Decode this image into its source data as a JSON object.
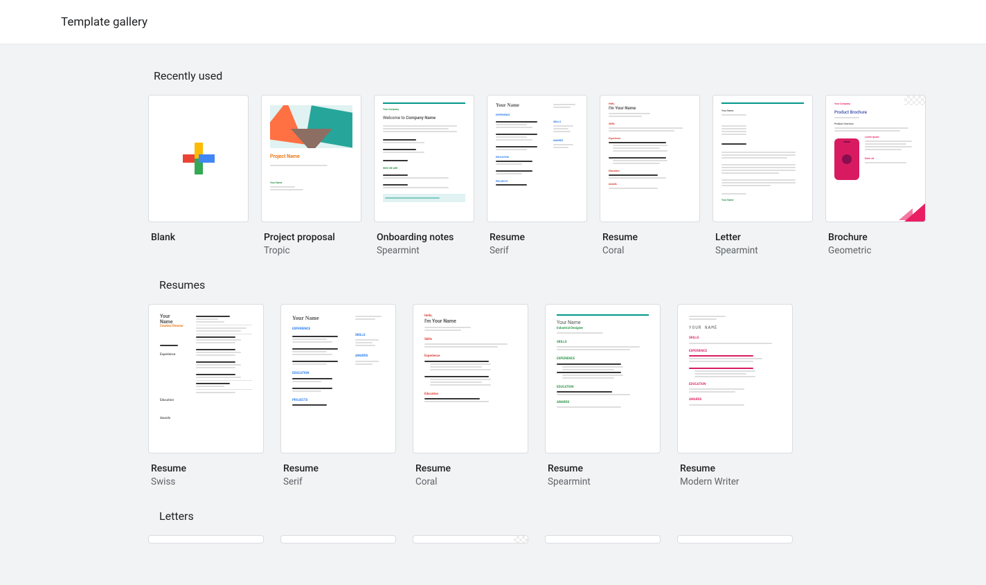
{
  "header": {
    "title": "Template gallery"
  },
  "sections": {
    "recent": {
      "title": "Recently used",
      "items": [
        {
          "title": "Blank",
          "subtitle": ""
        },
        {
          "title": "Project proposal",
          "subtitle": "Tropic"
        },
        {
          "title": "Onboarding notes",
          "subtitle": "Spearmint"
        },
        {
          "title": "Resume",
          "subtitle": "Serif"
        },
        {
          "title": "Resume",
          "subtitle": "Coral"
        },
        {
          "title": "Letter",
          "subtitle": "Spearmint"
        },
        {
          "title": "Brochure",
          "subtitle": "Geometric"
        }
      ]
    },
    "resumes": {
      "title": "Resumes",
      "items": [
        {
          "title": "Resume",
          "subtitle": "Swiss"
        },
        {
          "title": "Resume",
          "subtitle": "Serif"
        },
        {
          "title": "Resume",
          "subtitle": "Coral"
        },
        {
          "title": "Resume",
          "subtitle": "Spearmint"
        },
        {
          "title": "Resume",
          "subtitle": "Modern Writer"
        }
      ]
    },
    "letters": {
      "title": "Letters"
    }
  },
  "thumb_text": {
    "project_name": "Project Name",
    "onboarding_welcome": "Welcome to Company Name",
    "your_company": "Your Company",
    "your_name": "Your Name",
    "your_name_caps": "YOUR NAME",
    "im_your_name": "I'm Your Name",
    "product_brochure": "Product Brochure",
    "product_overview": "Product Overview",
    "creative_director": "Creative Director",
    "industrial_designer": "Industrial Designer",
    "experience": "EXPERIENCE",
    "experience_lc": "Experience",
    "education": "EDUCATION",
    "education_lc": "Education",
    "skills": "SKILLS",
    "skills_lc": "Skills",
    "projects": "PROJECTS",
    "awards": "AWARDS",
    "awards_lc": "Awards",
    "hello": "Hello,",
    "lorem_ipsum": "Lorem ipsum",
    "dolor_sit": "Dolor sit"
  }
}
